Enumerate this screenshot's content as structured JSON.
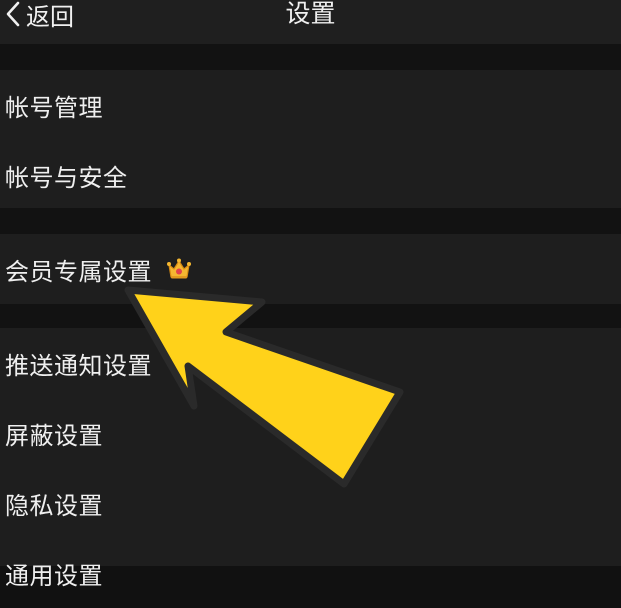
{
  "nav": {
    "back_label": "返回",
    "title": "设置"
  },
  "settings": {
    "group1": [
      "帐号管理",
      "帐号与安全"
    ],
    "group2": [
      "会员专属设置"
    ],
    "group3": [
      "推送通知设置",
      "屏蔽设置",
      "隐私设置",
      "通用设置"
    ]
  },
  "icons": {
    "back": "chevron-left-icon",
    "vip": "crown-icon"
  },
  "colors": {
    "background": "#111111",
    "row_background": "#1e1e1e",
    "text": "#efefef",
    "annotation_arrow": "#ffd21a"
  }
}
